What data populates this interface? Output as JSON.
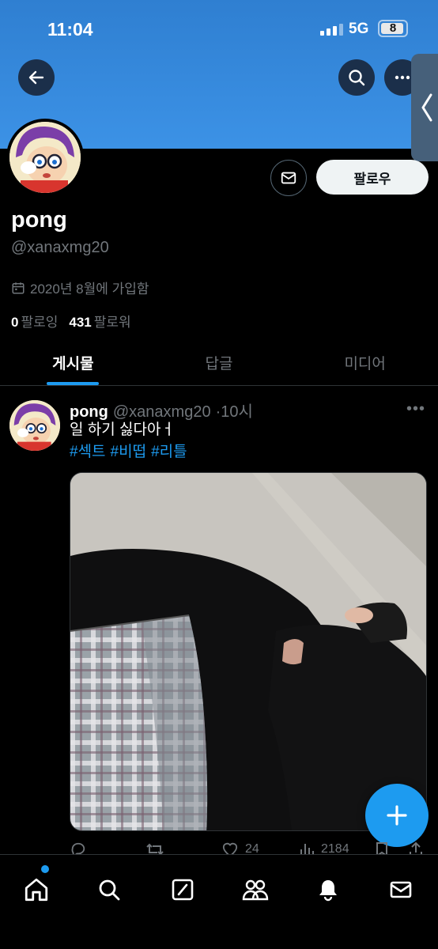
{
  "status_bar": {
    "time": "11:04",
    "network": "5G",
    "battery": "8"
  },
  "profile": {
    "name": "pong",
    "handle": "@xanaxmg20",
    "joined": "2020년 8월에 가입함",
    "following_count": "0",
    "following_label": "팔로잉",
    "followers_count": "431",
    "followers_label": "팔로워",
    "follow_button": "팔로우"
  },
  "tabs": [
    {
      "label": "게시물",
      "active": true
    },
    {
      "label": "답글",
      "active": false
    },
    {
      "label": "미디어",
      "active": false
    }
  ],
  "post": {
    "name": "pong",
    "handle": "@xanaxmg20",
    "time": "·10시",
    "text": "일 하기 싫다아ㅓ",
    "tags": [
      "#섹트",
      "#비떱",
      "#리틀"
    ],
    "likes": "24",
    "views": "2184"
  },
  "icons": {
    "back": "back-arrow-icon",
    "search": "search-icon",
    "more": "more-icon",
    "message": "envelope-icon",
    "compose": "plus-icon"
  },
  "colors": {
    "accent": "#1d9bf0",
    "banner": "#3c92e6",
    "background": "#000000"
  }
}
